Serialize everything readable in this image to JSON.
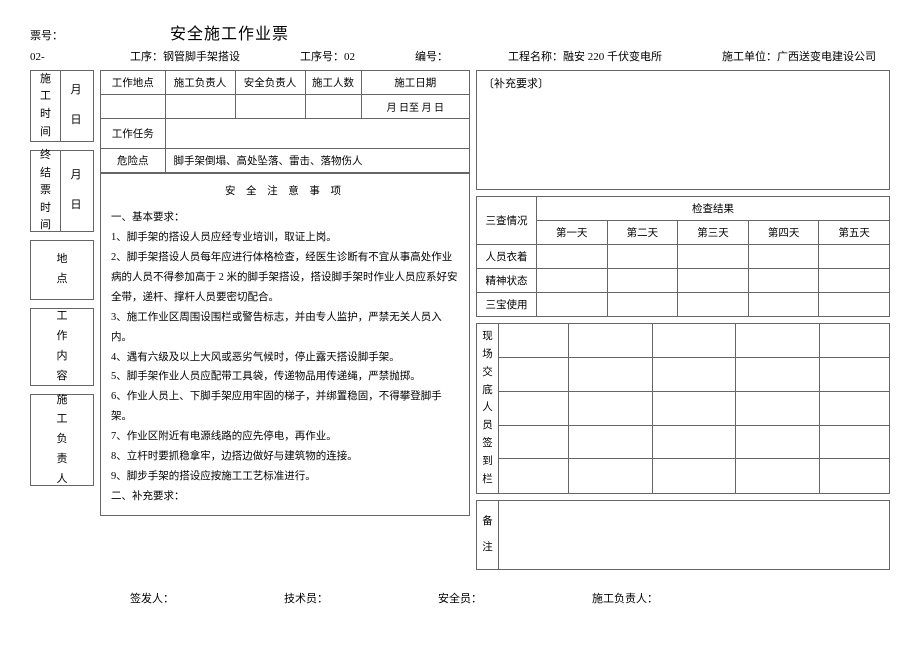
{
  "header": {
    "ticket_no_label": "票号：",
    "title": "安全施工作业票",
    "sub_no": "02-",
    "process_label": "工序：",
    "process_value": "钢管脚手架搭设",
    "process_no_label": "工序号：",
    "process_no_value": "02",
    "code_label": "编号：",
    "project_label": "工程名称：",
    "project_value": "融安    220 千伏变电所",
    "unit_label": "施工单位：",
    "unit_value": "广西送变电建设公司"
  },
  "left": {
    "construct_time": "施工时间",
    "month": "月",
    "day": "日",
    "end_time": "终结票时间",
    "location": "地点",
    "work_content": "工作内容",
    "construct_leader": "施工负责人"
  },
  "mid": {
    "cols": {
      "place": "工作地点",
      "leader": "施工负责人",
      "safety": "安全负责人",
      "count": "施工人数",
      "date": "施工日期",
      "date_fmt": "月   日至      月   日"
    },
    "task_label": "工作任务",
    "danger_label": "危险点",
    "danger_value": "脚手架倒塌、高处坠落、雷击、落物伤人",
    "safety_title": "安   全   注   意   事   项",
    "body": {
      "h1": "一、基本要求：",
      "p1": "1、脚手架的搭设人员应经专业培训，取证上岗。",
      "p2": "2、脚手架搭设人员每年应进行体格检查，经医生诊断有不宜从事高处作业病的人员不得参加高于     2  米的脚手架搭设，搭设脚手架时作业人员应系好安全带，递杆、撑杆人员要密切配合。",
      "p3": "3、施工作业区周围设围栏或警告标志，并由专人监护，严禁无关人员入内。",
      "p4": "4、遇有六级及以上大风或恶劣气候时，停止露天搭设脚手架。",
      "p5": "5、脚手架作业人员应配带工具袋，传递物品用传递绳，严禁抛掷。",
      "p6": "6、作业人员上、下脚手架应用牢固的梯子，并绑置稳固，不得攀登脚手架。",
      "p7": "7、作业区附近有电源线路的应先停电，再作业。",
      "p8": "8、立杆时要抓稳拿牢，边搭边做好与建筑物的连接。",
      "p9": "9、脚步手架的搭设应按施工工艺标准进行。",
      "h2": "二、补充要求："
    }
  },
  "right": {
    "supp_label": "〔补充要求〕",
    "check": {
      "situation": "三查情况",
      "result": "检查结果",
      "d1": "第一天",
      "d2": "第二天",
      "d3": "第三天",
      "d4": "第四天",
      "d5": "第五天",
      "r1": "人员衣着",
      "r2": "精神状态",
      "r3": "三宝使用"
    },
    "sign_label": "现场交底人员签到栏",
    "remark_label": "备注"
  },
  "footer": {
    "issuer": "签发人：",
    "tech": "技术员：",
    "safety": "安全员：",
    "leader": "施工负责人："
  }
}
